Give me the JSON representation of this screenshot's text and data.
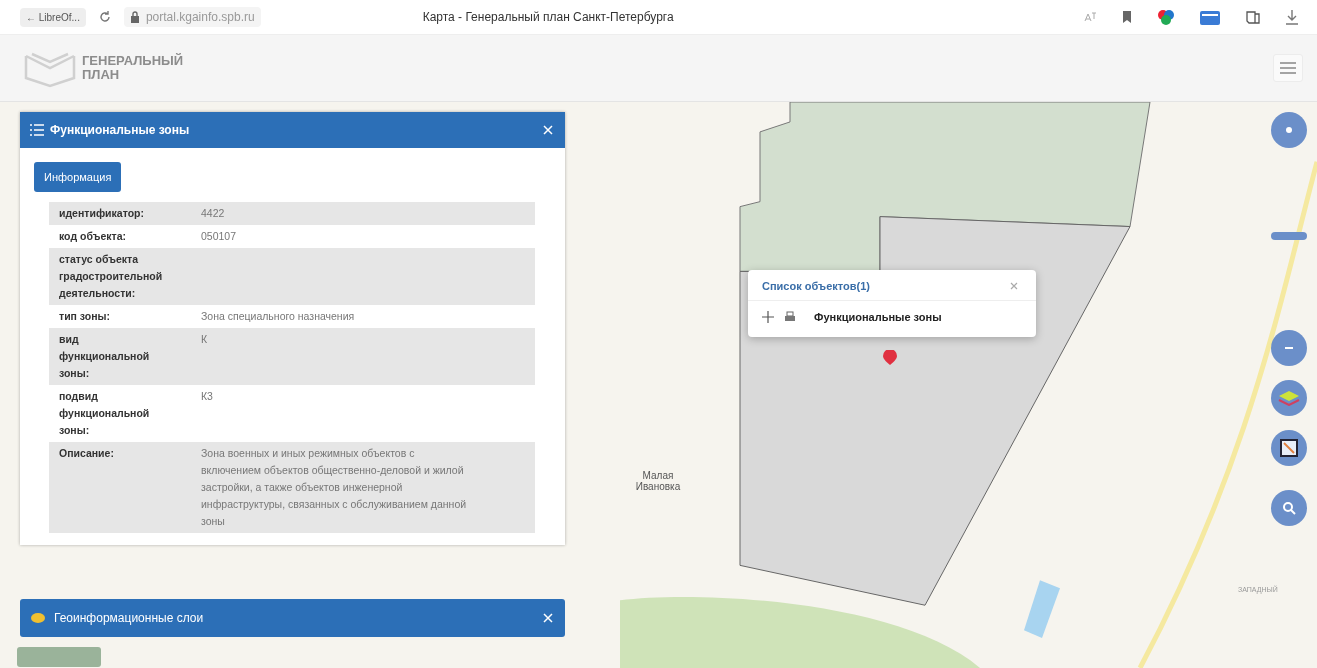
{
  "browser": {
    "back_button": "← LibreOf...",
    "url": "portal.kgainfo.spb.ru",
    "title": "Карта - Генеральный план Санкт-Петербурга"
  },
  "app_header": {
    "logo_lines": [
      "ГЕНЕРАЛЬНЫЙ",
      "ПЛАН"
    ]
  },
  "info_panel": {
    "title": "Функциональные зоны",
    "tabs": [
      {
        "label": "Информация",
        "selected": true
      }
    ],
    "rows": [
      {
        "label": "идентификатор:",
        "value": "4422"
      },
      {
        "label": "код объекта:",
        "value": "050107"
      },
      {
        "label": "статус объекта градостроительной деятельности:",
        "value": ""
      },
      {
        "label": "тип зоны:",
        "value": "Зона специального назначения"
      },
      {
        "label": "вид функциональной зоны:",
        "value": "К"
      },
      {
        "label": "подвид функциональной зоны:",
        "value": "К3"
      },
      {
        "label": "Описание:",
        "value": "Зона военных и иных режимных объектов с включением объектов общественно-деловой и жилой застройки, а также объектов инженерной инфраструктуры, связанных с обслуживанием данной зоны"
      }
    ]
  },
  "layers_panel": {
    "title": "Геоинформационные слои"
  },
  "popup": {
    "title": "Список объектов(1)",
    "items": [
      "Функциональные зоны"
    ]
  },
  "map_labels": [
    {
      "text": "Малая Ивановка"
    },
    {
      "text": "ЗАПАДНЫЙ"
    }
  ]
}
